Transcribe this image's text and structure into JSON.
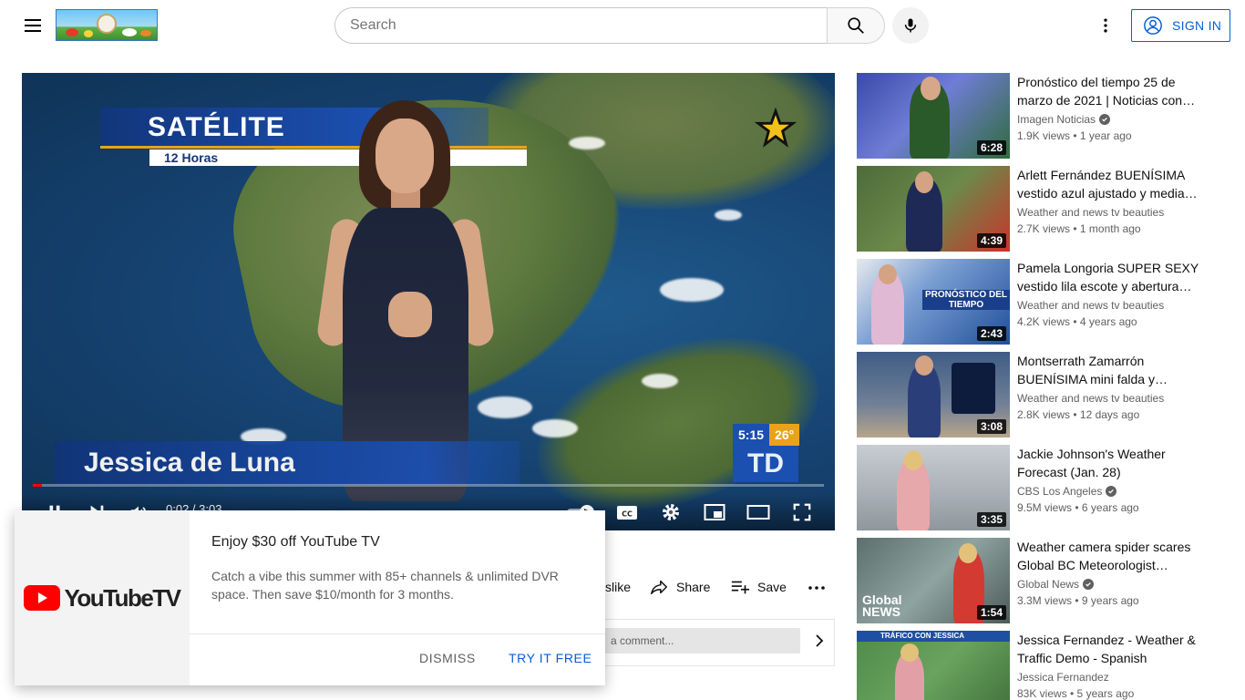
{
  "header": {
    "search_placeholder": "Search",
    "signin_label": "SIGN IN"
  },
  "player": {
    "overlay_title": "SATÉLITE",
    "overlay_subtitle": "12 Horas",
    "presenter_name": "Jessica de Luna",
    "clock": "5:15",
    "temperature": "26°",
    "station_logo": "TD",
    "time_display": "0:02 / 3:03",
    "progress": 0.011
  },
  "actions": {
    "dislike_label": "slike",
    "share_label": "Share",
    "save_label": "Save",
    "comment_placeholder": "a comment..."
  },
  "promo": {
    "brand": "YouTubeTV",
    "title": "Enjoy $30 off YouTube TV",
    "body": "Catch a vibe this summer with 85+ channels & unlimited DVR space. Then save $10/month for 3 months.",
    "dismiss_label": "DISMISS",
    "try_label": "TRY IT FREE"
  },
  "recommendations": [
    {
      "title": "Pronóstico del tiempo 25 de marzo de 2021 | Noticias con…",
      "channel": "Imagen Noticias",
      "verified": true,
      "meta": "1.9K views • 1 year ago",
      "duration": "6:28"
    },
    {
      "title": "Arlett Fernández BUENÍSIMA vestido azul ajustado y media…",
      "channel": "Weather and news tv beauties",
      "verified": false,
      "meta": "2.7K views • 1 month ago",
      "duration": "4:39"
    },
    {
      "title": "Pamela Longoria SUPER SEXY vestido lila escote y abertura e…",
      "channel": "Weather and news tv beauties",
      "verified": false,
      "meta": "4.2K views • 4 years ago",
      "duration": "2:43"
    },
    {
      "title": "Montserrath Zamarrón BUENÍSIMA mini falda y blusa…",
      "channel": "Weather and news tv beauties",
      "verified": false,
      "meta": "2.8K views • 12 days ago",
      "duration": "3:08"
    },
    {
      "title": "Jackie Johnson's Weather Forecast (Jan. 28)",
      "channel": "CBS Los Angeles",
      "verified": true,
      "meta": "9.5M views • 6 years ago",
      "duration": "3:35"
    },
    {
      "title": "Weather camera spider scares Global BC Meteorologist Kristi…",
      "channel": "Global News",
      "verified": true,
      "meta": "3.3M views • 9 years ago",
      "duration": "1:54"
    },
    {
      "title": "Jessica Fernandez - Weather & Traffic Demo - Spanish",
      "channel": "Jessica Fernandez",
      "verified": false,
      "meta": "83K views • 5 years ago",
      "duration": ""
    }
  ],
  "thumb_labels": {
    "t3": "PRONÓSTICO DEL TIEMPO",
    "t6": "Global NEWS",
    "t7": "TRÁFICO CON JESSICA"
  },
  "colors": {
    "accent_blue": "#065fd4",
    "progress_red": "#ff0000",
    "text_primary": "#0f0f0f",
    "text_secondary": "#606060"
  }
}
